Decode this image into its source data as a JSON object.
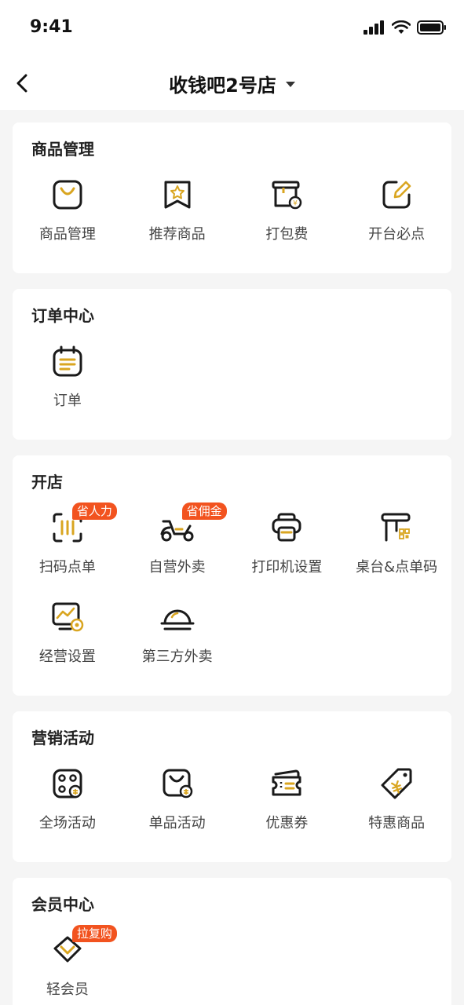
{
  "status_bar": {
    "time": "9:41"
  },
  "nav": {
    "store_name": "收钱吧2号店"
  },
  "colors": {
    "accent": "#d9a520",
    "badge": "#f2531f",
    "icon_stroke": "#1a1a1a"
  },
  "sections": [
    {
      "title": "商品管理",
      "items": [
        {
          "label": "商品管理",
          "icon": "shopping-bag-icon"
        },
        {
          "label": "推荐商品",
          "icon": "star-bookmark-icon"
        },
        {
          "label": "打包费",
          "icon": "package-fee-icon"
        },
        {
          "label": "开台必点",
          "icon": "edit-pencil-icon"
        }
      ]
    },
    {
      "title": "订单中心",
      "items": [
        {
          "label": "订单",
          "icon": "order-list-icon"
        }
      ]
    },
    {
      "title": "开店",
      "items": [
        {
          "label": "扫码点单",
          "icon": "scan-order-icon",
          "badge": "省人力"
        },
        {
          "label": "自营外卖",
          "icon": "scooter-icon",
          "badge": "省佣金"
        },
        {
          "label": "打印机设置",
          "icon": "printer-icon"
        },
        {
          "label": "桌台&点单码",
          "icon": "table-qr-icon"
        },
        {
          "label": "经营设置",
          "icon": "business-settings-icon"
        },
        {
          "label": "第三方外卖",
          "icon": "food-cloche-icon"
        }
      ]
    },
    {
      "title": "营销活动",
      "items": [
        {
          "label": "全场活动",
          "icon": "store-activity-icon"
        },
        {
          "label": "单品活动",
          "icon": "item-activity-icon"
        },
        {
          "label": "优惠券",
          "icon": "coupon-icon"
        },
        {
          "label": "特惠商品",
          "icon": "price-tag-icon"
        }
      ]
    },
    {
      "title": "会员中心",
      "items": [
        {
          "label": "轻会员",
          "icon": "member-diamond-icon",
          "badge": "拉复购"
        }
      ]
    }
  ]
}
